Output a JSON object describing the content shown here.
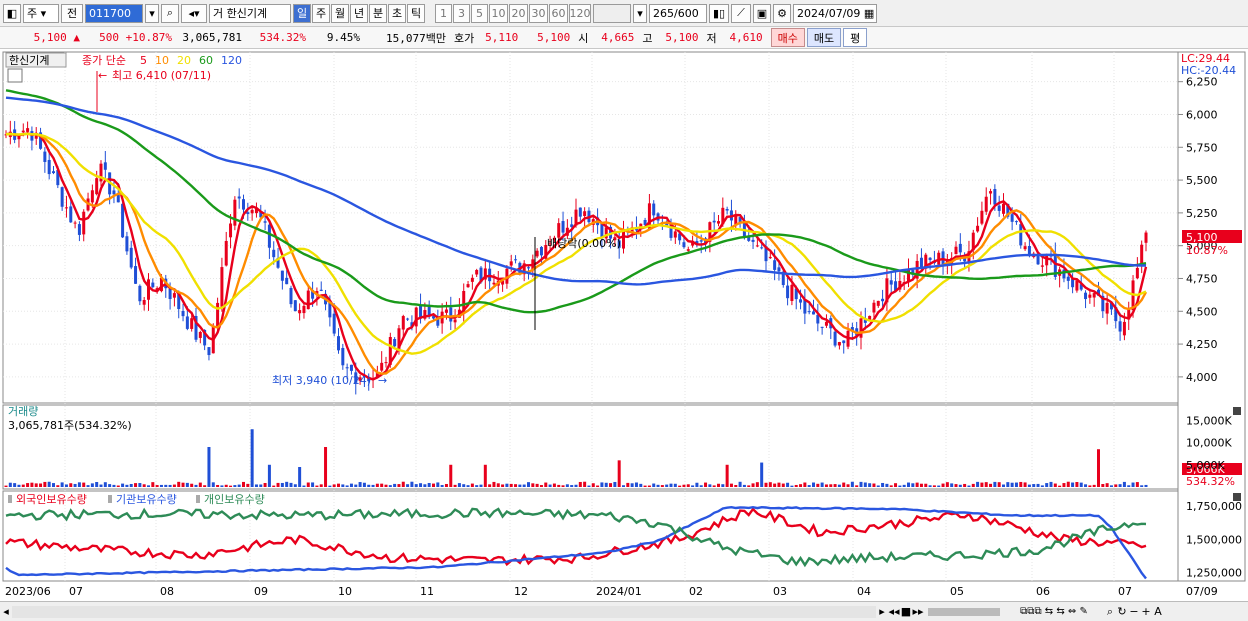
{
  "toolbar": {
    "period_type": "주",
    "prev_label": "전",
    "code": "011700",
    "search_icon": "search-icon",
    "name_prefix": "거",
    "stock_name": "한신기계",
    "period_buttons": [
      "일",
      "주",
      "월",
      "년",
      "분",
      "초",
      "틱"
    ],
    "active_period": "일",
    "interval_buttons": [
      "1",
      "3",
      "5",
      "10",
      "20",
      "30",
      "60",
      "120"
    ],
    "count": "265",
    "count_max": "/600",
    "date": "2024/07/09"
  },
  "quote": {
    "price": "5,100",
    "change_arrow": "▲",
    "change": "500",
    "change_pct": "+10.87%",
    "volume": "3,065,781",
    "volume_ratio": "534.32%",
    "turnover": "9.45%",
    "amount": "15,077백만",
    "ask_label": "호가",
    "ask": "5,110",
    "bid": "5,100",
    "open_label": "시",
    "open": "4,665",
    "high_label": "고",
    "high": "5,100",
    "low_label": "저",
    "low": "4,610",
    "buy_label": "매수",
    "sell_label": "매도",
    "eval_label": "평"
  },
  "price_panel": {
    "stock_tag": "한신기계",
    "legend_prefix": "종가 단순",
    "ma": [
      {
        "period": "5",
        "color": "#e8001c"
      },
      {
        "period": "10",
        "color": "#ff8c00"
      },
      {
        "period": "20",
        "color": "#f0e000"
      },
      {
        "period": "60",
        "color": "#1a9a1a"
      },
      {
        "period": "120",
        "color": "#2a56e0"
      }
    ],
    "high_note": "최고 6,410 (07/11)",
    "low_note": "최저 3,940 (10/24)",
    "dividend_note": "배당락(0.00%)",
    "lc": "LC:29.44",
    "hc": "HC:-20.44",
    "price_ticks": [
      "6,250",
      "6,000",
      "5,750",
      "5,500",
      "5,250",
      "5,000",
      "4,750",
      "4,500",
      "4,250",
      "4,000"
    ],
    "current_price_tag": "5,100",
    "current_change_tag": "10.87%"
  },
  "volume_panel": {
    "title": "거래량",
    "value": "3,065,781주(534.32%)",
    "ticks": [
      "15,000K",
      "10,000K",
      "5,000K"
    ],
    "current_tag": "3,066K",
    "current_pct": "534.32%"
  },
  "holding_panel": {
    "series": [
      {
        "name": "외국인보유수량",
        "color": "#e8001c"
      },
      {
        "name": "기관보유수량",
        "color": "#2a56e0"
      },
      {
        "name": "개인보유수량",
        "color": "#2e8b57"
      }
    ],
    "ticks": [
      "1,750,000",
      "1,500,000",
      "1,250,000"
    ]
  },
  "x_axis": [
    "2023/06",
    "07",
    "08",
    "09",
    "10",
    "11",
    "12",
    "2024/01",
    "02",
    "03",
    "04",
    "05",
    "06",
    "07",
    "07/09"
  ],
  "colors": {
    "up": "#e8001c",
    "down": "#1f4fd6",
    "accent": "#2f6bd6"
  },
  "chart_data": {
    "type": "line",
    "title": "한신기계",
    "series": [
      {
        "name": "120",
        "values": [
          6150,
          6000,
          5850,
          5700,
          5600,
          5500,
          5300,
          5100,
          4950,
          4750,
          4720,
          4740,
          4800,
          4800,
          4850,
          4900,
          4950
        ]
      },
      {
        "name": "60",
        "values": [
          6200,
          6050,
          5750,
          5400,
          5250,
          5050,
          4950,
          4700,
          4600,
          4700,
          5050,
          5190,
          5200,
          4950,
          4870,
          4750,
          4700
        ]
      }
    ],
    "ylim": [
      3900,
      6400
    ]
  }
}
